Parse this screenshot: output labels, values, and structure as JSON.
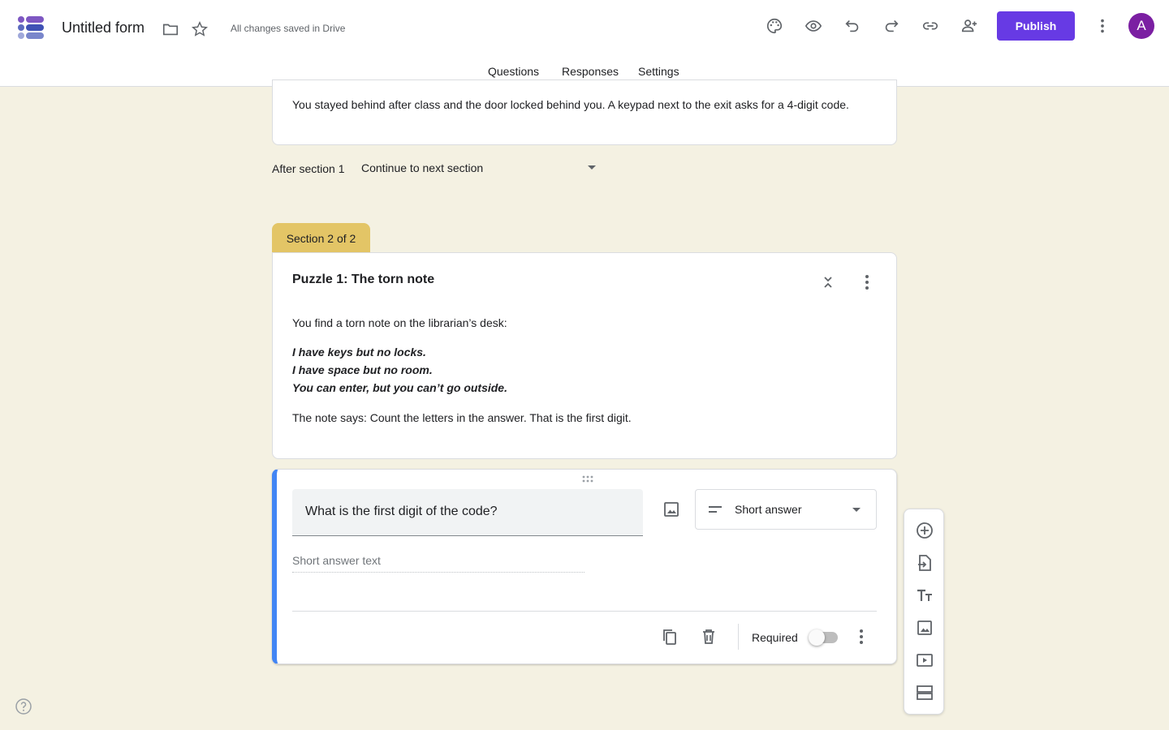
{
  "header": {
    "title": "Untitled form",
    "saved_status": "All changes saved in Drive",
    "publish_label": "Publish",
    "avatar_initial": "A",
    "accent_color": "#673ae4"
  },
  "tabs": [
    {
      "label": "Questions",
      "active": true
    },
    {
      "label": "Responses",
      "active": false
    },
    {
      "label": "Settings",
      "active": false
    }
  ],
  "section1": {
    "description": "You stayed behind after class and the door locked behind you. A keypad next to the exit asks for a 4-digit code.",
    "after_label": "After section 1",
    "after_value": "Continue to next section"
  },
  "section2": {
    "tab_label": "Section 2 of 2",
    "title": "Puzzle 1: The torn note",
    "intro": "You find a torn note on the librarian’s desk:",
    "riddle": [
      "I have keys but no locks.",
      "I have space but no room.",
      "You can enter, but you can’t go outside."
    ],
    "instruction": "The note says: Count the letters in the answer. That is the first digit."
  },
  "question": {
    "title": "What is the first digit of the code?",
    "type": "Short answer",
    "answer_placeholder": "Short answer text",
    "required_label": "Required",
    "required": false
  },
  "icons": {
    "header": [
      "palette-icon",
      "preview-eye-icon",
      "undo-icon",
      "redo-icon",
      "link-icon",
      "add-collaborator-icon",
      "more-vert-icon"
    ],
    "toolbar": [
      "add-question-icon",
      "import-questions-icon",
      "add-title-icon",
      "add-image-icon",
      "add-video-icon",
      "add-section-icon"
    ]
  }
}
